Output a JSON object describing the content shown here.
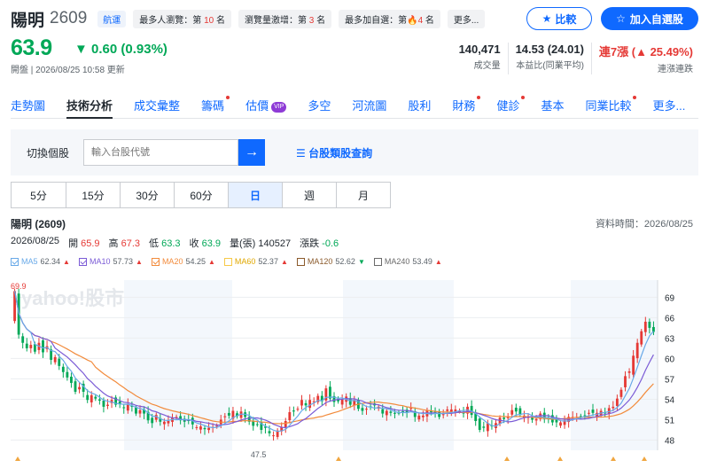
{
  "header": {
    "stock_name": "陽明",
    "stock_code": "2609",
    "industry_badge": "航運",
    "tags": [
      {
        "prefix": "最多人瀏覽：第",
        "rank": "10",
        "suffix": "名"
      },
      {
        "prefix": "瀏覽量激增：第",
        "rank": "3",
        "suffix": "名"
      },
      {
        "prefix": "最多加自選：第",
        "rank": "4",
        "suffix": "名"
      }
    ],
    "more_label": "更多...",
    "compare_label": "比較",
    "add_watchlist_label": "加入自選股"
  },
  "quote": {
    "price": "63.9",
    "change": "▼ 0.60 (0.93%)",
    "status_time": "開盤 | 2026/08/25 10:58 更新",
    "colors": {
      "up": "#e53935",
      "down": "#00a857",
      "accent": "#0f69ff"
    }
  },
  "stats": [
    {
      "value": "140,471",
      "label": "成交量"
    },
    {
      "value": "14.53 (24.01)",
      "label": "本益比(同業平均)"
    },
    {
      "value": "連7漲 (▲ 25.49%)",
      "label": "連漲連跌"
    }
  ],
  "tabs": [
    {
      "label": "走勢圖",
      "dot": false
    },
    {
      "label": "技術分析",
      "dot": false,
      "active": true
    },
    {
      "label": "成交彙整",
      "dot": false
    },
    {
      "label": "籌碼",
      "dot": true
    },
    {
      "label": "估價",
      "dot": false,
      "vip": "VIP"
    },
    {
      "label": "多空",
      "dot": false
    },
    {
      "label": "河流圖",
      "dot": false
    },
    {
      "label": "股利",
      "dot": false
    },
    {
      "label": "財務",
      "dot": true
    },
    {
      "label": "健診",
      "dot": true
    },
    {
      "label": "基本",
      "dot": false
    },
    {
      "label": "同業比較",
      "dot": true
    },
    {
      "label": "更多...",
      "dot": false
    }
  ],
  "search": {
    "label": "切換個股",
    "placeholder": "輸入台股代號",
    "submit_icon": "arrow-right-icon",
    "link_label": "台股類股查詢"
  },
  "periods": [
    {
      "label": "5分"
    },
    {
      "label": "15分"
    },
    {
      "label": "30分"
    },
    {
      "label": "60分"
    },
    {
      "label": "日",
      "active": true
    },
    {
      "label": "週"
    },
    {
      "label": "月"
    }
  ],
  "chart_header": {
    "title": "陽明 (2609)",
    "data_time": "資料時間：2026/08/25",
    "date": "2026/08/25",
    "open_label": "開",
    "open": "65.9",
    "high_label": "高",
    "high": "67.3",
    "low_label": "低",
    "low": "63.3",
    "close_label": "收",
    "close": "63.9",
    "volume_label": "量(張)",
    "volume": "140527",
    "change_label": "漲跌",
    "change": "-0.6"
  },
  "ma_legend": [
    {
      "name": "MA5",
      "value": "62.34",
      "dir": "up",
      "color": "#68a9e8",
      "checked": true
    },
    {
      "name": "MA10",
      "value": "57.73",
      "dir": "up",
      "color": "#7b5bd6",
      "checked": true
    },
    {
      "name": "MA20",
      "value": "54.25",
      "dir": "up",
      "color": "#f28b3c",
      "checked": true
    },
    {
      "name": "MA60",
      "value": "52.37",
      "dir": "up",
      "color": "#f7c948",
      "checked": false
    },
    {
      "name": "MA120",
      "value": "52.62",
      "dir": "down",
      "color": "#8b5a2b",
      "checked": false
    },
    {
      "name": "MA240",
      "value": "53.49",
      "dir": "up",
      "color": "#6b6b6b",
      "checked": false
    }
  ],
  "chart_data": {
    "type": "candlestick",
    "watermark": "yahoo!股市",
    "y_ticks": [
      69,
      66,
      63,
      60,
      57,
      54,
      51,
      48
    ],
    "ylim": [
      46.5,
      71
    ],
    "max_label": "69.9",
    "min_label": "47.5",
    "up_color": "#e53935",
    "down_color": "#00a857",
    "closes": [
      69.9,
      63.5,
      62.3,
      61.5,
      62.0,
      61.0,
      62.3,
      60.9,
      61.8,
      59.8,
      60.2,
      58.9,
      58.0,
      57.2,
      56.4,
      55.1,
      55.8,
      55.1,
      53.9,
      54.6,
      54.1,
      53.8,
      52.9,
      53.2,
      53.9,
      53.2,
      53.3,
      52.7,
      53.3,
      52.9,
      51.9,
      52.4,
      51.9,
      50.9,
      50.5,
      51.7,
      50.7,
      50.7,
      50.8,
      51.3,
      51.4,
      50.9,
      50.7,
      50.8,
      50.3,
      49.9,
      50.0,
      49.6,
      49.8,
      49.9,
      50.1,
      51.0,
      51.5,
      51.6,
      52.3,
      51.5,
      52.2,
      51.4,
      50.7,
      50.1,
      50.3,
      49.5,
      49.8,
      49.0,
      48.7,
      49.4,
      49.9,
      50.8,
      52.1,
      52.2,
      52.6,
      53.9,
      53.1,
      53.9,
      53.7,
      54.5,
      53.7,
      55.6,
      54.1,
      53.6,
      53.7,
      54.0,
      54.4,
      53.2,
      53.9,
      52.6,
      52.3,
      52.6,
      52.9,
      53.1,
      52.9,
      51.9,
      52.3,
      52.0,
      51.9,
      52.0,
      52.1,
      52.1,
      52.7,
      51.4,
      51.6,
      51.6,
      52.3,
      52.1,
      52.0,
      51.4,
      51.8,
      52.5,
      52.5,
      52.5,
      52.3,
      51.9,
      52.9,
      51.7,
      50.8,
      49.5,
      49.8,
      50.5,
      50.0,
      50.5,
      51.3,
      51.1,
      51.5,
      52.4,
      52.2,
      51.7,
      51.6,
      51.5,
      51.0,
      51.1,
      51.9,
      51.1,
      51.3,
      50.6,
      50.6,
      50.6,
      50.9,
      51.4,
      51.4,
      51.4,
      51.4,
      51.6,
      52.0,
      52.0,
      52.0,
      52.3,
      52.0,
      52.7,
      52.9,
      54.1,
      55.4,
      57.4,
      58.1,
      60.4,
      62.3,
      64.0,
      65.4,
      64.5,
      63.9
    ],
    "ma5_last": 62.34,
    "ma10_last": 57.73,
    "ma20_last": 54.25
  }
}
